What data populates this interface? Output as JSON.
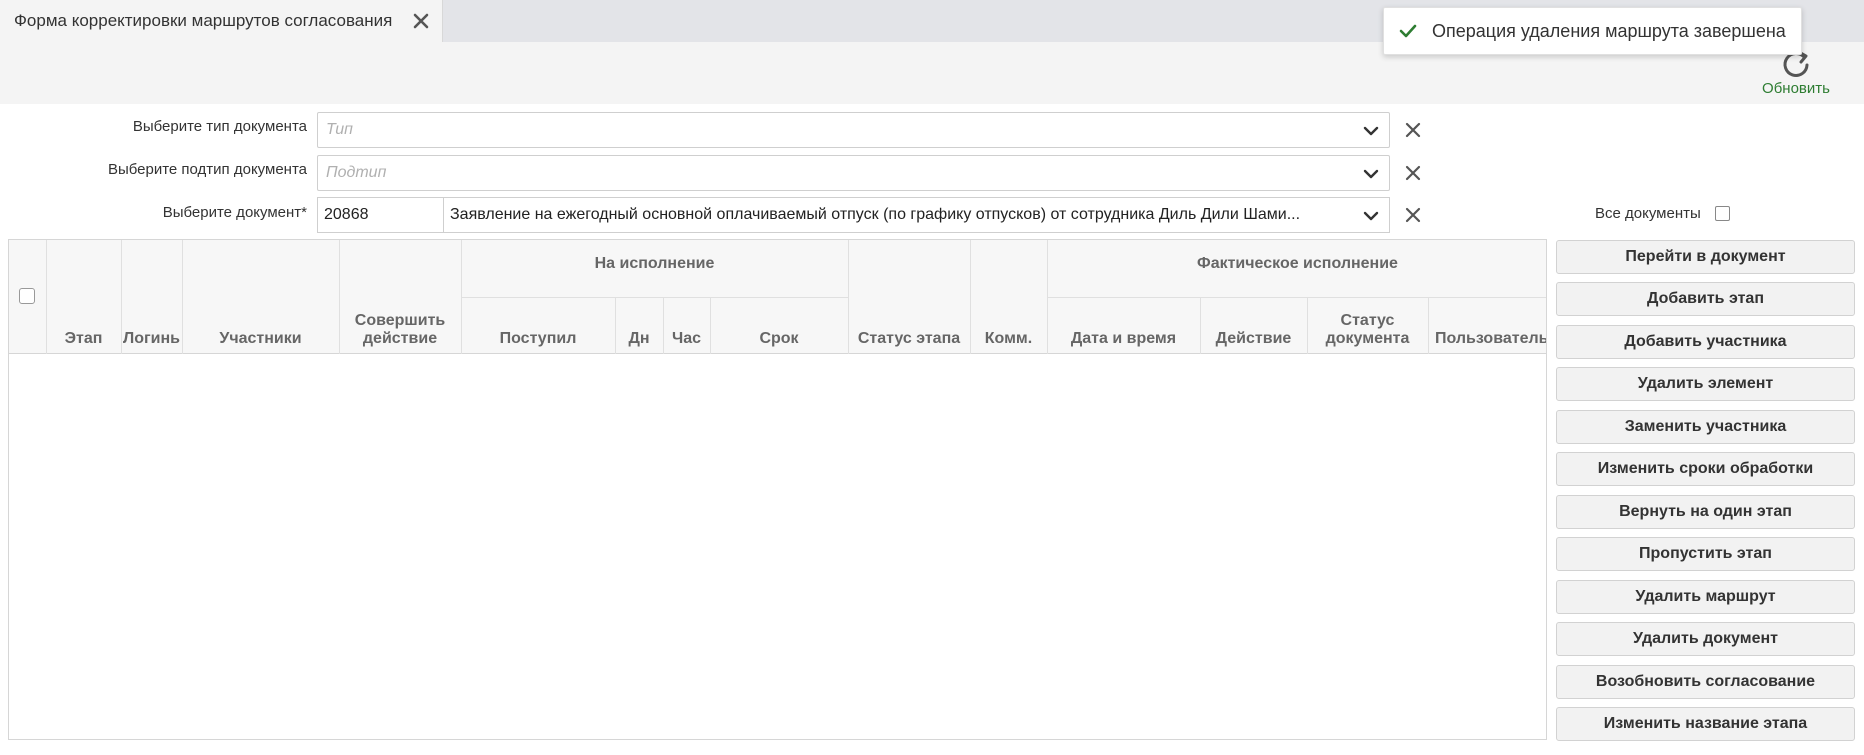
{
  "tab": {
    "title": "Форма корректировки маршрутов согласования"
  },
  "toolbar": {
    "refresh_label": "Обновить"
  },
  "toast": {
    "message": "Операция удаления маршрута завершена"
  },
  "form": {
    "doc_type": {
      "label": "Выберите тип документа",
      "placeholder": "Тип"
    },
    "doc_subtype": {
      "label": "Выберите подтип документа",
      "placeholder": "Подтип"
    },
    "document": {
      "label": "Выберите документ*",
      "number": "20868",
      "name": "Заявление на ежегодный основной оплачиваемый отпуск (по графику отпусков) от сотрудника Диль Дили Шами..."
    },
    "all_docs_label": "Все документы"
  },
  "table": {
    "group_headers": {
      "in_work": "На исполнение",
      "actual": "Фактическое исполнение"
    },
    "columns": {
      "stage": "Этап",
      "login": "Логинь",
      "participants": "Участники",
      "action": "Совершить действие",
      "received": "Поступил",
      "days": "Дн",
      "hours": "Час",
      "deadline": "Срок",
      "stage_status": "Статус этапа",
      "comments": "Комм.",
      "datetime": "Дата и время",
      "act": "Действие",
      "doc_status": "Статус документа",
      "user": "Пользователь"
    },
    "rows": []
  },
  "buttons": {
    "goto_doc": "Перейти в документ",
    "add_stage": "Добавить этап",
    "add_participant": "Добавить участника",
    "delete_element": "Удалить элемент",
    "replace_participant": "Заменить участника",
    "change_deadlines": "Изменить сроки обработки",
    "return_stage": "Вернуть на один этап",
    "skip_stage": "Пропустить этап",
    "delete_route": "Удалить маршрут",
    "delete_document": "Удалить документ",
    "resume_approval": "Возобновить согласование",
    "rename_stage": "Изменить название этапа"
  },
  "colors": {
    "accent_green": "#2e7d32",
    "toast_check": "#2e7d32"
  }
}
